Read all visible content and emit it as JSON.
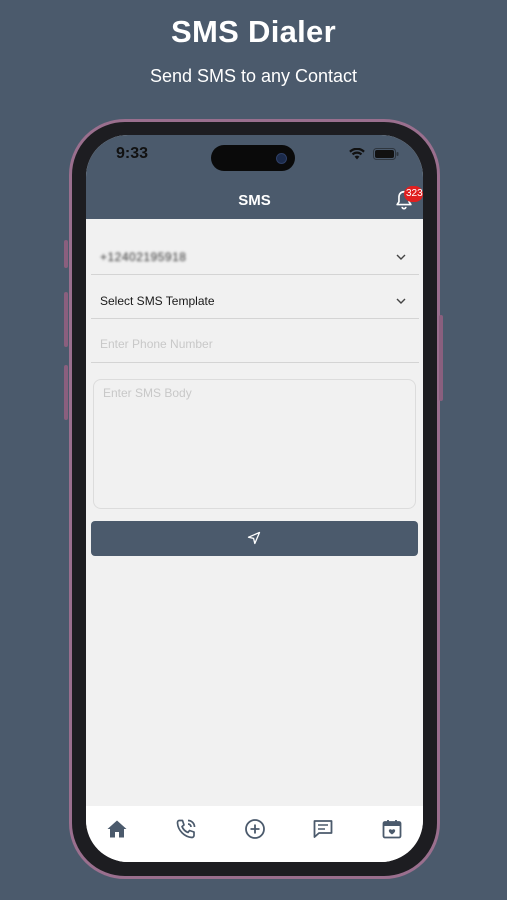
{
  "promo": {
    "title": "SMS Dialer",
    "subtitle": "Send SMS to any Contact"
  },
  "status_bar": {
    "time": "9:33"
  },
  "header": {
    "title": "SMS",
    "notification_count": "323",
    "color": "#4b5a6c"
  },
  "form": {
    "sender_number": "+12402195918",
    "template_select": "Select SMS Template",
    "phone_placeholder": "Enter Phone Number",
    "body_placeholder": "Enter SMS Body"
  },
  "icons": {
    "send": "send-icon",
    "nav": [
      "home-icon",
      "phone-call-icon",
      "add-circle-icon",
      "message-icon",
      "calendar-icon"
    ]
  },
  "colors": {
    "background": "#4b5a6c",
    "badge": "#e02020",
    "screen_bg": "#f1f1f1"
  }
}
